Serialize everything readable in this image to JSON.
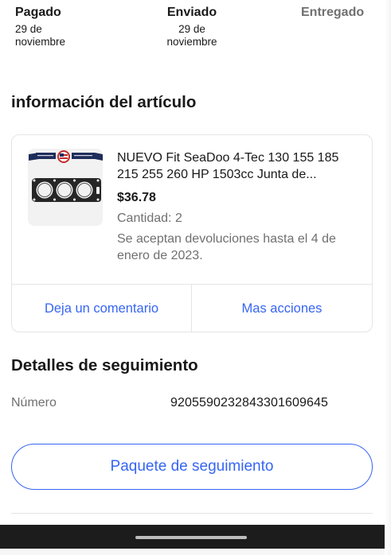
{
  "status": {
    "paid": {
      "label": "Pagado",
      "date_line1": "29 de",
      "date_line2": "noviembre"
    },
    "shipped": {
      "label": "Enviado",
      "date_line1": "29 de",
      "date_line2": "noviembre"
    },
    "delivered": {
      "label": "Entregado"
    }
  },
  "item_section": {
    "title": "información del artículo",
    "item": {
      "title": "NUEVO Fit SeaDoo 4-Tec 130 155 185 215 255 260 HP 1503cc Junta de...",
      "price": "$36.78",
      "quantity": "Cantidad: 2",
      "returns": "Se aceptan devoluciones hasta el 4 de enero de 2023.",
      "thumb_icon": "head-gasket-product-image"
    },
    "actions": {
      "feedback": "Deja un comentario",
      "more": "Mas acciones"
    }
  },
  "tracking": {
    "title": "Detalles de seguimiento",
    "number_label": "Número",
    "number_value": "9205590232843301609645",
    "button_label": "Paquete de seguimiento"
  },
  "colors": {
    "link_blue": "#3665f3",
    "text": "#191919",
    "muted": "#707070"
  }
}
